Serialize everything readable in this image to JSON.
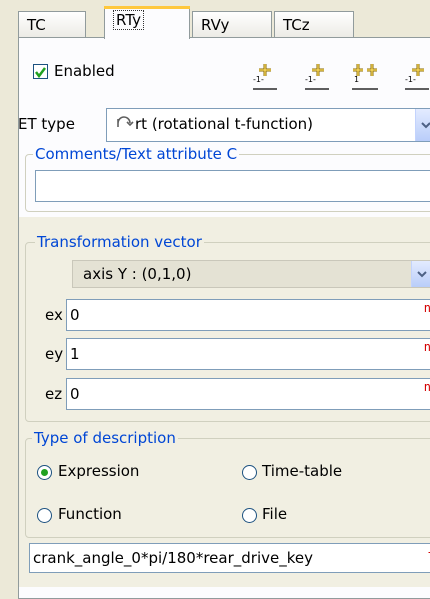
{
  "tabs": [
    "TC",
    "RTy",
    "RVy",
    "TCz"
  ],
  "enabled": {
    "label": "Enabled",
    "checked": true
  },
  "toolbar_icons": [
    "add-icon",
    "add-down-icon",
    "add-pair-icon",
    "add-more-icon"
  ],
  "et_type": {
    "label": "ET type",
    "value": "rt (rotational t-function)"
  },
  "comments": {
    "title": "Comments/Text attribute C",
    "value": ""
  },
  "transformation": {
    "title": "Transformation vector",
    "axis": "axis Y : (0,1,0)",
    "ex": {
      "label": "ex",
      "value": "0"
    },
    "ey": {
      "label": "ey",
      "value": "1"
    },
    "ez": {
      "label": "ez",
      "value": "0"
    },
    "n_marker": "n"
  },
  "description": {
    "title": "Type of description",
    "options": [
      "Expression",
      "Time-table",
      "Function",
      "File"
    ],
    "selected": "Expression"
  },
  "expression": {
    "value": "crank_angle_0*pi/180*rear_drive_key",
    "marker": "t"
  },
  "colors": {
    "group_title": "#0046d5",
    "tab_highlight": "#ffc83c",
    "radio_on": "#21a121"
  }
}
